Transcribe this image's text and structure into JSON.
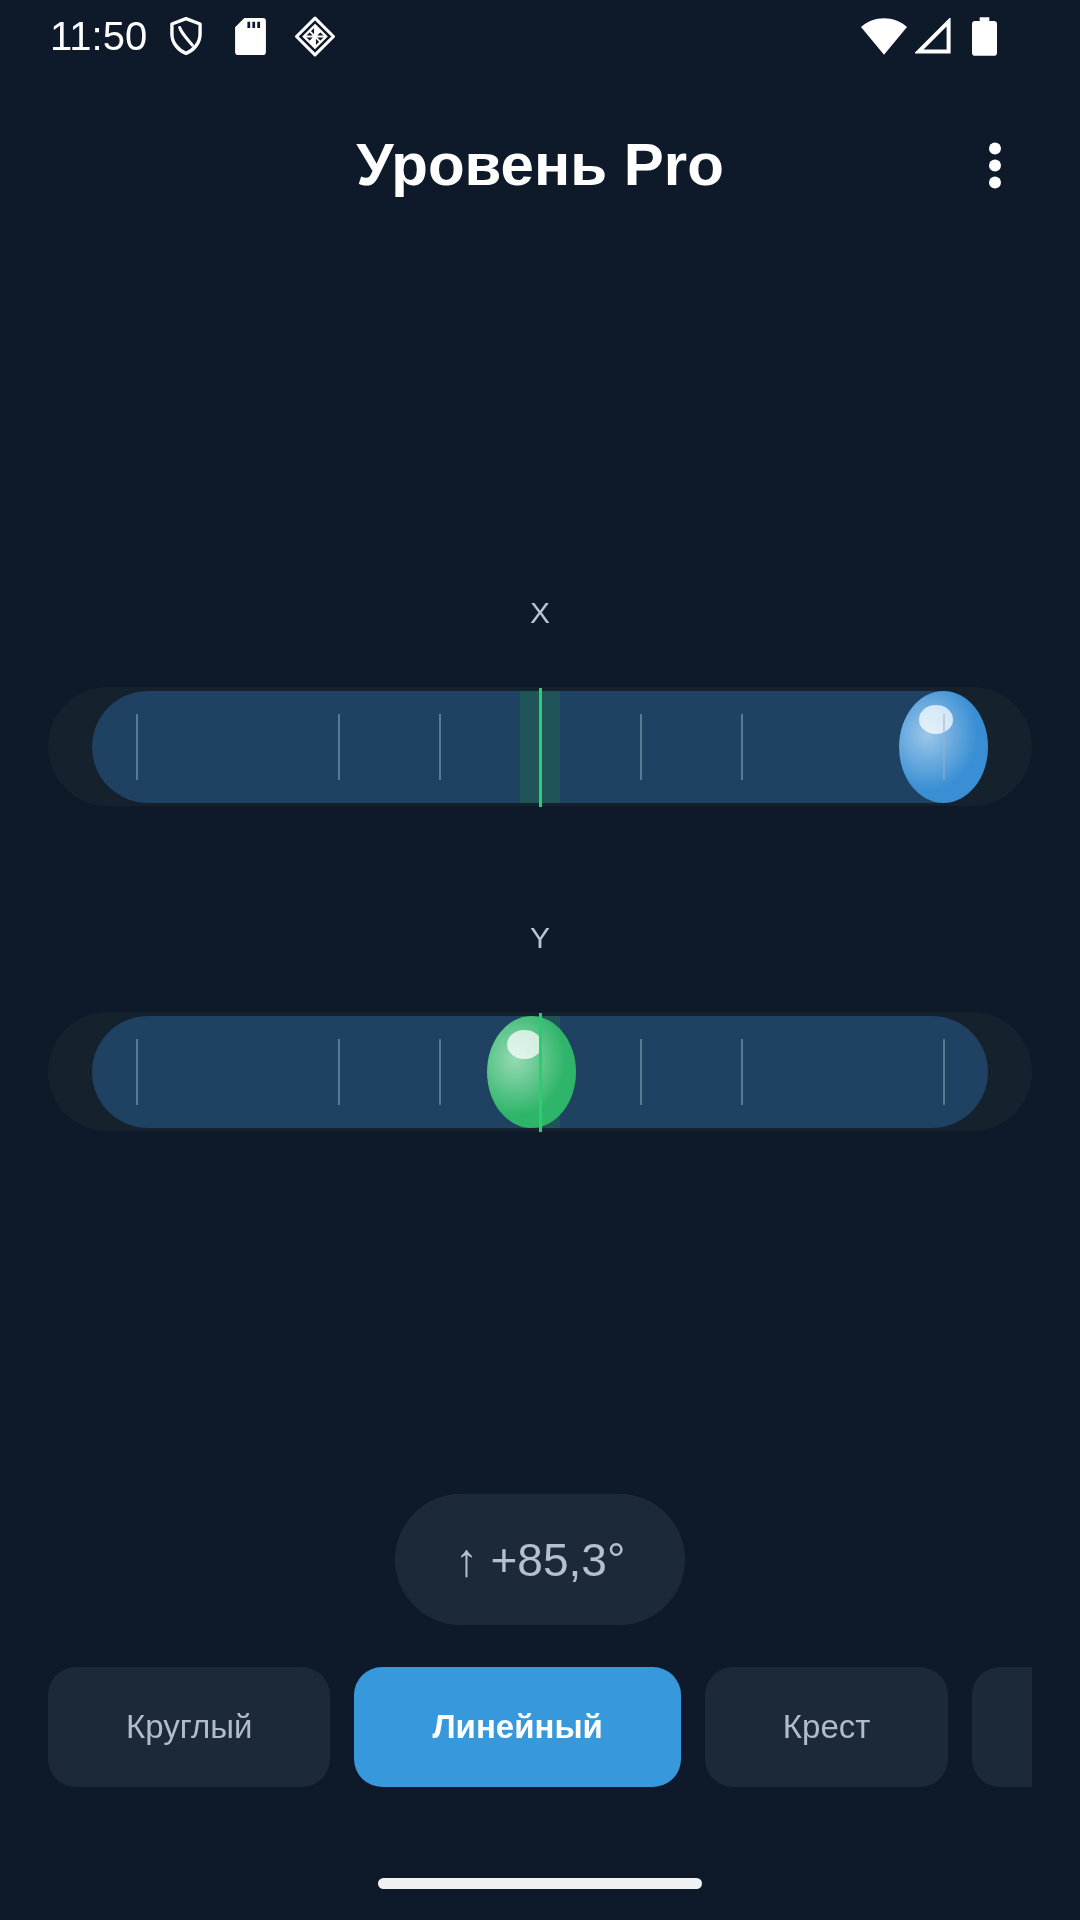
{
  "status_bar": {
    "time": "11:50"
  },
  "app_bar": {
    "title": "Уровень Pro"
  },
  "axes": [
    {
      "label": "X",
      "level": 1,
      "color": "#3a8fd4"
    },
    {
      "label": "Y",
      "level": 0.49,
      "color": "#2fb56a"
    }
  ],
  "readout": "↑ +85,3°",
  "tabs": [
    {
      "label": "Круглый",
      "selected": false
    },
    {
      "label": "Линейный",
      "selected": true
    },
    {
      "label": "Крест",
      "selected": false
    },
    {
      "selected": false
    }
  ]
}
